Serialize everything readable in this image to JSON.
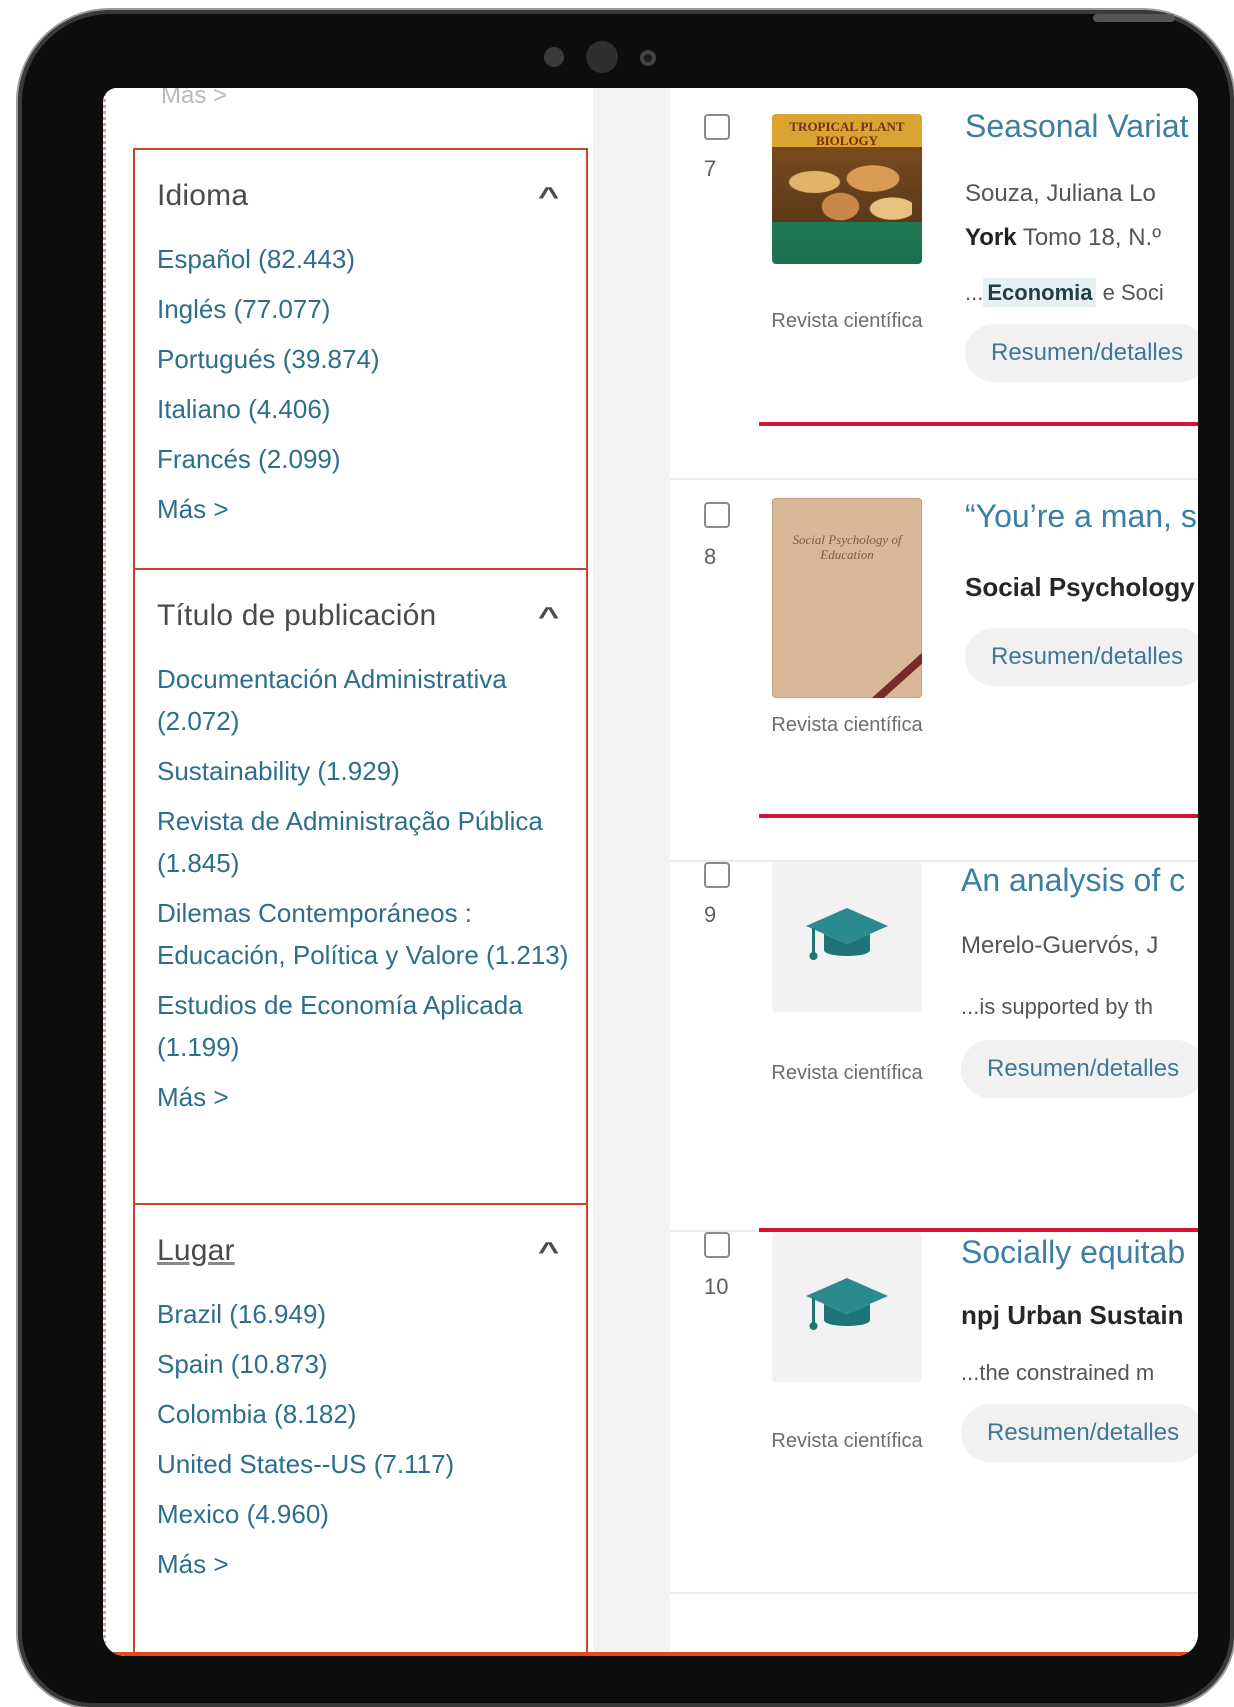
{
  "sidebar": {
    "top_more": "Más >",
    "facets": [
      {
        "title": "Idioma",
        "items": [
          "Español (82.443)",
          "Inglés (77.077)",
          "Portugués (39.874)",
          "Italiano (4.406)",
          "Francés (2.099)"
        ],
        "more": "Más >"
      },
      {
        "title": "Título de publicación",
        "items": [
          "Documentación Administrativa (2.072)",
          "Sustainability (1.929)",
          "Revista de Administração Pública (1.845)",
          "Dilemas Contemporáneos : Educación, Política y Valore (1.213)",
          "Estudios de Economía Aplicada (1.199)"
        ],
        "more": "Más >"
      },
      {
        "title": "Lugar",
        "items": [
          "Brazil (16.949)",
          "Spain (10.873)",
          "Colombia (8.182)",
          "United States--US (7.117)",
          "Mexico (4.960)"
        ],
        "more": "Más >"
      }
    ]
  },
  "results": [
    {
      "number": "7",
      "title": "Seasonal Variat",
      "authors": "Souza, Juliana Lo",
      "source_bold": "York",
      "source_rest": " Tomo 18, N.º",
      "keyword": "Economia",
      "keyword_after": " e Soci",
      "snippet_lead": "...",
      "type": "Revista científica",
      "cover_title": "TROPICAL PLANT BIOLOGY",
      "button": "Resumen/detalles"
    },
    {
      "number": "8",
      "title": "“You’re a man, s",
      "publication": "Social Psychology",
      "type": "Revista científica",
      "cover_title": "Social Psychology of Education",
      "button": "Resumen/detalles"
    },
    {
      "number": "9",
      "title": "An analysis of c",
      "authors": "Merelo-Guervós, J",
      "snippet": "...is supported by th",
      "type": "Revista científica",
      "button": "Resumen/detalles"
    },
    {
      "number": "10",
      "title": "Socially equitab",
      "publication": "npj Urban Sustain",
      "snippet": "...the constrained m",
      "type": "Revista científica",
      "button": "Resumen/detalles"
    }
  ],
  "icons": [
    "chevron-up-icon",
    "graduation-cap-icon",
    "checkbox-icon"
  ],
  "colors": {
    "link": "#2d6f8a",
    "title_link": "#3c7fa1",
    "facet_border": "#c8452a",
    "annotation_line": "#d41431"
  }
}
